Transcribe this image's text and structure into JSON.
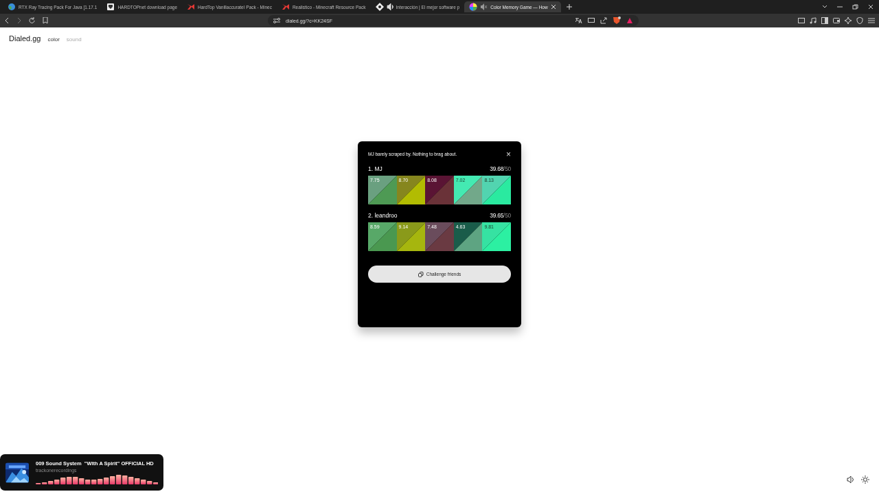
{
  "browser": {
    "tabs": [
      {
        "title": "RTX Ray Tracing Pack For Java [1.17.1",
        "kind": "globe",
        "sound_playing": false,
        "muted": false,
        "selected": false
      },
      {
        "title": "HARDTOPnet download page",
        "kind": "shield",
        "sound_playing": false,
        "muted": false,
        "selected": false
      },
      {
        "title": "HardTop VanillaccurateI Pack - Minec",
        "kind": "flag",
        "sound_playing": false,
        "muted": false,
        "selected": false
      },
      {
        "title": "Realistico - Minecraft Resource Pack",
        "kind": "flag",
        "sound_playing": false,
        "muted": false,
        "selected": false
      },
      {
        "title": "Interacción | El mejor software p",
        "kind": "diamond",
        "sound_playing": true,
        "muted": false,
        "selected": false
      },
      {
        "title": "Color Memory Game — How",
        "kind": "wheel",
        "sound_playing": false,
        "muted": true,
        "selected": true
      }
    ],
    "url": "dialed.gg/?c=KK24SF"
  },
  "site": {
    "logo": "Dialed.gg",
    "nav": [
      {
        "label": "color",
        "selected": true
      },
      {
        "label": "sound",
        "selected": false
      }
    ]
  },
  "modal": {
    "message": "MJ barely scraped by. Nothing to brag about.",
    "close": "×",
    "players": [
      {
        "rank_name": "1. MJ",
        "score": "39.68",
        "max": "/50",
        "swatches": [
          {
            "score": "7.75",
            "target": {
              "color": "#6aa080"
            },
            "guess": {
              "color": "#4e9a54"
            }
          },
          {
            "score": "8.70",
            "target": {
              "color": "#86861e"
            },
            "guess": {
              "color": "#b2bc02"
            }
          },
          {
            "score": "8.08",
            "target": {
              "color": "#5a1434"
            },
            "guess": {
              "color": "#6a3238"
            }
          },
          {
            "score": "7.02",
            "target": {
              "color": "#44eab2"
            },
            "guess": {
              "color": "#72a88a"
            }
          },
          {
            "score": "8.13",
            "target": {
              "color": "#52d4b0"
            },
            "guess": {
              "color": "#2aeaa0"
            }
          }
        ]
      },
      {
        "rank_name": "2. leandroo",
        "score": "39.65",
        "max": "/50",
        "swatches": [
          {
            "score": "8.59",
            "target": {
              "color": "#58a868"
            },
            "guess": {
              "color": "#4a9850"
            }
          },
          {
            "score": "9.14",
            "target": {
              "color": "#8a9a1a"
            },
            "guess": {
              "color": "#a6b60e"
            }
          },
          {
            "score": "7.48",
            "target": {
              "color": "#6a4c5c"
            },
            "guess": {
              "color": "#6a3a42"
            }
          },
          {
            "score": "4.63",
            "target": {
              "color": "#1a5c4a"
            },
            "guess": {
              "color": "#5ea482"
            }
          },
          {
            "score": "9.81",
            "target": {
              "color": "#36e2a2"
            },
            "guess": {
              "color": "#2cf0a2"
            }
          }
        ]
      }
    ],
    "button": "Challenge friends"
  },
  "media": {
    "title": "009 Sound System  \"With A Spirit\" OFFICIAL HD",
    "artist": "trackonerecordings"
  }
}
